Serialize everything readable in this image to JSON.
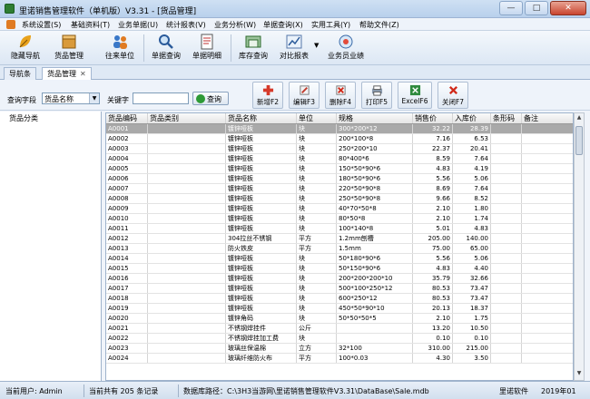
{
  "window": {
    "title": "里诺销售管理软件（单机版）V3.31 - [货品管理]",
    "min": "—",
    "max": "□",
    "close": "✕"
  },
  "menu": [
    "系统设置(S)",
    "基础资料(T)",
    "业务单据(U)",
    "统计报表(V)",
    "业务分析(W)",
    "单据查询(X)",
    "实用工具(Y)",
    "帮助文件(Z)"
  ],
  "toolbar": [
    "隐藏导航",
    "货品管理",
    "往来单位",
    "单据查询",
    "单据明细",
    "库存查询",
    "对比报表",
    "业务员业绩"
  ],
  "tabs": {
    "nav": "导航条",
    "goods": "货品管理",
    "close": "✕"
  },
  "search": {
    "field_label": "查询字段",
    "field_value": "货品名称",
    "keyword_label": "关键字",
    "keyword_value": "",
    "query_label": "查询"
  },
  "actions": [
    "新增F2",
    "编辑F3",
    "删除F4",
    "打印F5",
    "ExcelF6",
    "关闭F7"
  ],
  "tree": {
    "root": "货品分类"
  },
  "grid": {
    "headers": [
      "货品编码",
      "货品类别",
      "货品名称",
      "单位",
      "规格",
      "销售价",
      "入库价",
      "条形码",
      "备注"
    ],
    "rows": [
      [
        "A0001",
        "",
        "镀锌哑板",
        "块",
        "300*200*12",
        "32.22",
        "28.39"
      ],
      [
        "A0002",
        "",
        "镀锌哑板",
        "块",
        "200*100*8",
        "7.16",
        "6.53"
      ],
      [
        "A0003",
        "",
        "镀锌哑板",
        "块",
        "250*200*10",
        "22.37",
        "20.41"
      ],
      [
        "A0004",
        "",
        "镀锌哑板",
        "块",
        "80*400*6",
        "8.59",
        "7.64"
      ],
      [
        "A0005",
        "",
        "镀锌哑板",
        "块",
        "150*50*90*6",
        "4.83",
        "4.19"
      ],
      [
        "A0006",
        "",
        "镀锌哑板",
        "块",
        "180*50*90*6",
        "5.56",
        "5.06"
      ],
      [
        "A0007",
        "",
        "镀锌哑板",
        "块",
        "220*50*90*8",
        "8.69",
        "7.64"
      ],
      [
        "A0008",
        "",
        "镀锌哑板",
        "块",
        "250*50*90*8",
        "9.66",
        "8.52"
      ],
      [
        "A0009",
        "",
        "镀锌哑板",
        "块",
        "40*70*50*8",
        "2.10",
        "1.80"
      ],
      [
        "A0010",
        "",
        "镀锌哑板",
        "块",
        "80*50*8",
        "2.10",
        "1.74"
      ],
      [
        "A0011",
        "",
        "镀锌哑板",
        "块",
        "100*140*8",
        "5.01",
        "4.83"
      ],
      [
        "A0012",
        "",
        "304拉丝不锈钢",
        "平方",
        "1.2mm刨槽",
        "205.00",
        "140.00"
      ],
      [
        "A0013",
        "",
        "防火铁皮",
        "平方",
        "1.5mm",
        "75.00",
        "65.00"
      ],
      [
        "A0014",
        "",
        "镀锌哑板",
        "块",
        "50*180*90*6",
        "5.56",
        "5.06"
      ],
      [
        "A0015",
        "",
        "镀锌哑板",
        "块",
        "50*150*90*6",
        "4.83",
        "4.40"
      ],
      [
        "A0016",
        "",
        "镀锌哑板",
        "块",
        "200*200*200*10",
        "35.79",
        "32.66"
      ],
      [
        "A0017",
        "",
        "镀锌哑板",
        "块",
        "500*100*250*12",
        "80.53",
        "73.47"
      ],
      [
        "A0018",
        "",
        "镀锌哑板",
        "块",
        "600*250*12",
        "80.53",
        "73.47"
      ],
      [
        "A0019",
        "",
        "镀锌哑板",
        "块",
        "450*50*90*10",
        "20.13",
        "18.37"
      ],
      [
        "A0020",
        "",
        "镀锌角码",
        "块",
        "50*50*50*5",
        "2.10",
        "1.75"
      ],
      [
        "A0021",
        "",
        "不锈钢焊挂件",
        "公斤",
        "",
        "13.20",
        "10.50"
      ],
      [
        "A0022",
        "",
        "不锈钢焊挂加工费",
        "块",
        "",
        "0.10",
        "0.10"
      ],
      [
        "A0023",
        "",
        "玻璃丝保温棉",
        "立方",
        "32*100",
        "310.00",
        "215.00"
      ],
      [
        "A0024",
        "",
        "玻璃纤维防火布",
        "平方",
        "100*0.03",
        "4.30",
        "3.50"
      ]
    ]
  },
  "status": {
    "user": "当前用户: Admin",
    "count": "当前共有 205 条记录",
    "db": "数据库路径：C:\\3H3当游网\\里诺销售管理软件V3.31\\DataBase\\Sale.mdb",
    "app": "里诺软件",
    "date": "2019年01"
  },
  "colors": {
    "accent": "#2e7d32",
    "selected_row": "#a9a9a9"
  }
}
